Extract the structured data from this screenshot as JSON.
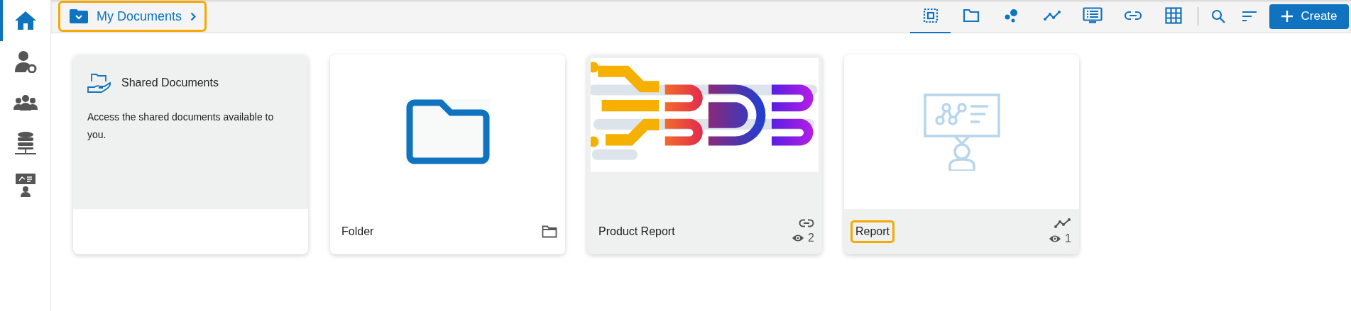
{
  "sidebar": {
    "items": [
      {
        "kind": "home",
        "selected": true
      },
      {
        "kind": "user-settings",
        "selected": false
      },
      {
        "kind": "group",
        "selected": false
      },
      {
        "kind": "database",
        "selected": false
      },
      {
        "kind": "presenter",
        "selected": false
      }
    ]
  },
  "breadcrumb": {
    "label": "My Documents",
    "highlighted": true
  },
  "toolbar": {
    "tabs": [
      {
        "kind": "all",
        "selected": true
      },
      {
        "kind": "folder",
        "selected": false
      },
      {
        "kind": "bubbles",
        "selected": false
      },
      {
        "kind": "line",
        "selected": false
      },
      {
        "kind": "monitor",
        "selected": false
      },
      {
        "kind": "link",
        "selected": false
      },
      {
        "kind": "grid",
        "selected": false
      }
    ],
    "create_button": "Create"
  },
  "cards": [
    {
      "kind": "info",
      "title": "Shared Documents",
      "description": "Access the shared documents available to you."
    },
    {
      "kind": "folder",
      "title": "Folder",
      "highlighted": false
    },
    {
      "kind": "link",
      "title": "Product Report",
      "views": "2",
      "highlighted": false
    },
    {
      "kind": "report",
      "title": "Report",
      "views": "1",
      "highlighted": true
    }
  ]
}
